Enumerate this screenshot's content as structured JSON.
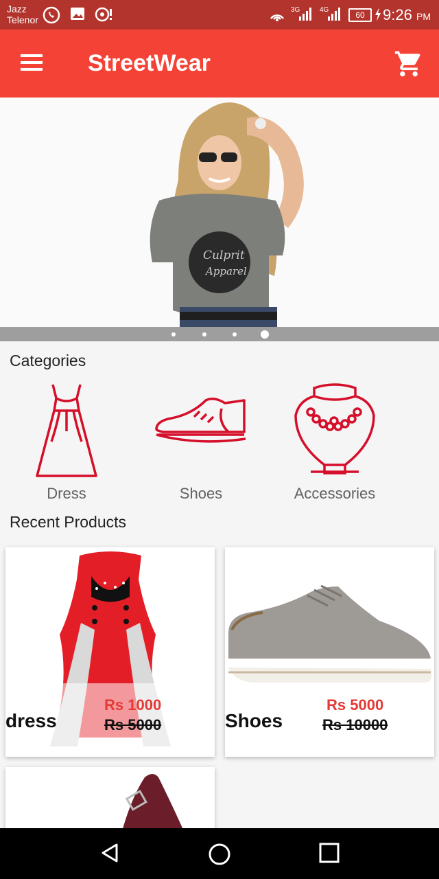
{
  "status_bar": {
    "carrier_line1": "Jazz",
    "carrier_line2": "Telenor",
    "battery": "60",
    "time": "9:26",
    "ampm": "PM",
    "network_1": "3G",
    "network_2": "4G"
  },
  "app_bar": {
    "title": "StreetWear",
    "menu_icon": "hamburger-menu-icon",
    "cart_icon": "shopping-cart-icon",
    "color": "#f44336"
  },
  "banner": {
    "printed_text": "Culprit Apparel",
    "slide_count": 4,
    "active_slide": 4
  },
  "categories": {
    "title": "Categories",
    "items": [
      {
        "label": "Dress",
        "icon": "dress-icon"
      },
      {
        "label": "Shoes",
        "icon": "shoe-icon"
      },
      {
        "label": "Accessories",
        "icon": "necklace-icon"
      }
    ]
  },
  "recent_products": {
    "title": "Recent Products",
    "items": [
      {
        "name": "dress",
        "price": "Rs 1000",
        "old_price": "Rs 5000"
      },
      {
        "name": "Shoes",
        "price": "Rs 5000",
        "old_price": "Rs 10000"
      }
    ]
  },
  "nav_bar": {
    "buttons": [
      "back-icon",
      "home-icon",
      "recents-icon"
    ]
  }
}
